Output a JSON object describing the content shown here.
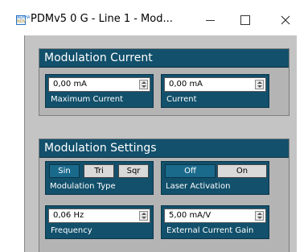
{
  "window": {
    "title": "PDMv5 0 G - Line 1 - Mod...",
    "icon_top": "ALPHA",
    "icon_bottom": "NOV"
  },
  "modulation_current": {
    "title": "Modulation Current",
    "maximum_current": {
      "value": "0,00 mA",
      "label": "Maximum Current"
    },
    "current": {
      "value": "0,00 mA",
      "label": "Current"
    }
  },
  "modulation_settings": {
    "title": "Modulation Settings",
    "type": {
      "options": [
        "Sin",
        "Tri",
        "Sqr"
      ],
      "selected": "Sin",
      "label": "Modulation Type"
    },
    "laser": {
      "options": [
        "Off",
        "On"
      ],
      "selected": "Off",
      "label": "Laser Activation"
    },
    "frequency": {
      "value": "0,06 Hz",
      "label": "Frequency"
    },
    "gain": {
      "value": "5,00 mA/V",
      "label": "External Current Gain"
    }
  },
  "colors": {
    "panel_header": "#12506b",
    "selected_toggle": "#1a6a8c",
    "panel_bg": "#c4c4c4"
  }
}
